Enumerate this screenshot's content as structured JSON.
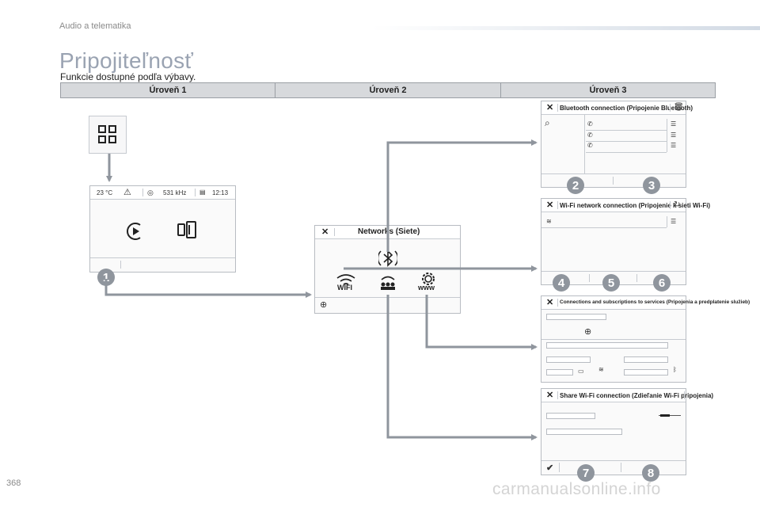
{
  "header": {
    "section": "Audio a telematika"
  },
  "page": {
    "title": "Pripojiteľnosť",
    "subtitle": "Funkcie dostupné podľa výbavy.",
    "number": "368"
  },
  "levels": [
    "Úroveň 1",
    "Úroveň 2",
    "Úroveň 3"
  ],
  "home_screen": {
    "temperature": "23 °C",
    "radio": "531 kHz",
    "time": "12:13",
    "badge": "1"
  },
  "networks": {
    "title": "Networks (Siete)",
    "wifi_label": "WIFI",
    "www_label": "www"
  },
  "bluetooth": {
    "title": "Bluetooth connection (Pripojenie Bluetooth)",
    "badges": [
      "2",
      "3"
    ]
  },
  "wifi": {
    "title": "Wi-Fi network connection (Pripojenie k sieti Wi-Fi)",
    "badges": [
      "4",
      "5",
      "6"
    ]
  },
  "services": {
    "title": "Connections and subscriptions to services (Pripojenia a predplatenie služieb)"
  },
  "share": {
    "title": "Share Wi-Fi connection (Zdieľanie Wi-Fi pripojenia)",
    "badges": [
      "7",
      "8"
    ]
  },
  "watermark": "carmanualsonline.info",
  "colors": {
    "arrow": "#8f959d",
    "badge": "#8f959d",
    "title": "#9aa3b2"
  }
}
